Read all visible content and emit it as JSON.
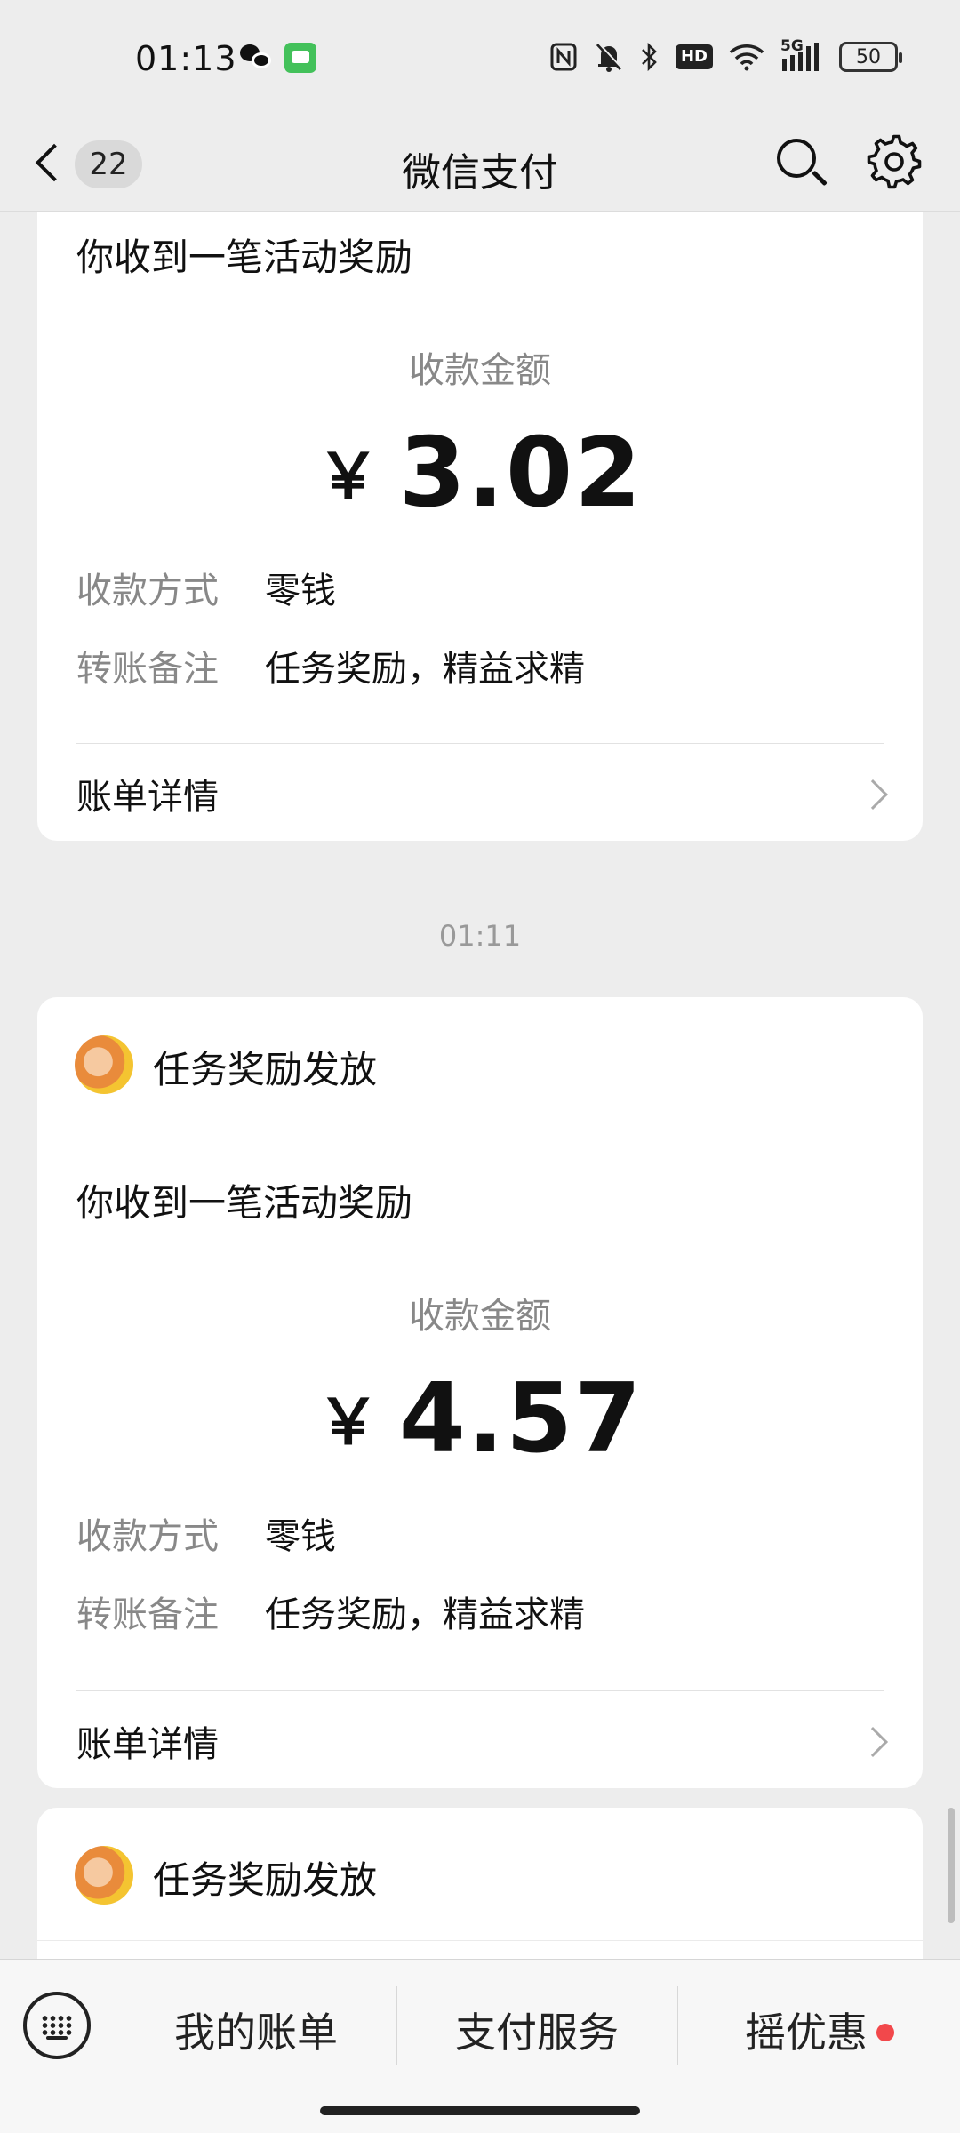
{
  "status_bar": {
    "time": "01:13",
    "network": "5G",
    "hd_label": "HD",
    "battery": "50",
    "icons": [
      "wechat-icon",
      "message-icon",
      "nfc-icon",
      "mute-icon",
      "bluetooth-icon",
      "hd-icon",
      "wifi-icon",
      "signal-icon",
      "battery-icon"
    ]
  },
  "nav": {
    "back_count": "22",
    "title": "微信支付"
  },
  "cards": [
    {
      "notice": "你收到一笔活动奖励",
      "amount_label": "收款金额",
      "currency": "￥",
      "amount": "3.02",
      "method_key": "收款方式",
      "method_value": "零钱",
      "note_key": "转账备注",
      "note_value": "任务奖励，精益求精",
      "detail_label": "账单详情"
    },
    {
      "sender": "任务奖励发放",
      "notice": "你收到一笔活动奖励",
      "amount_label": "收款金额",
      "currency": "￥",
      "amount": "4.57",
      "method_key": "收款方式",
      "method_value": "零钱",
      "note_key": "转账备注",
      "note_value": "任务奖励，精益求精",
      "detail_label": "账单详情"
    },
    {
      "sender": "任务奖励发放"
    }
  ],
  "time_separator": "01:11",
  "bottom_menu": {
    "items": [
      "我的账单",
      "支付服务",
      "摇优惠"
    ]
  },
  "colors": {
    "background": "#ededed",
    "card": "#ffffff",
    "muted_text": "#888888",
    "badge_dot": "#f2484b"
  }
}
